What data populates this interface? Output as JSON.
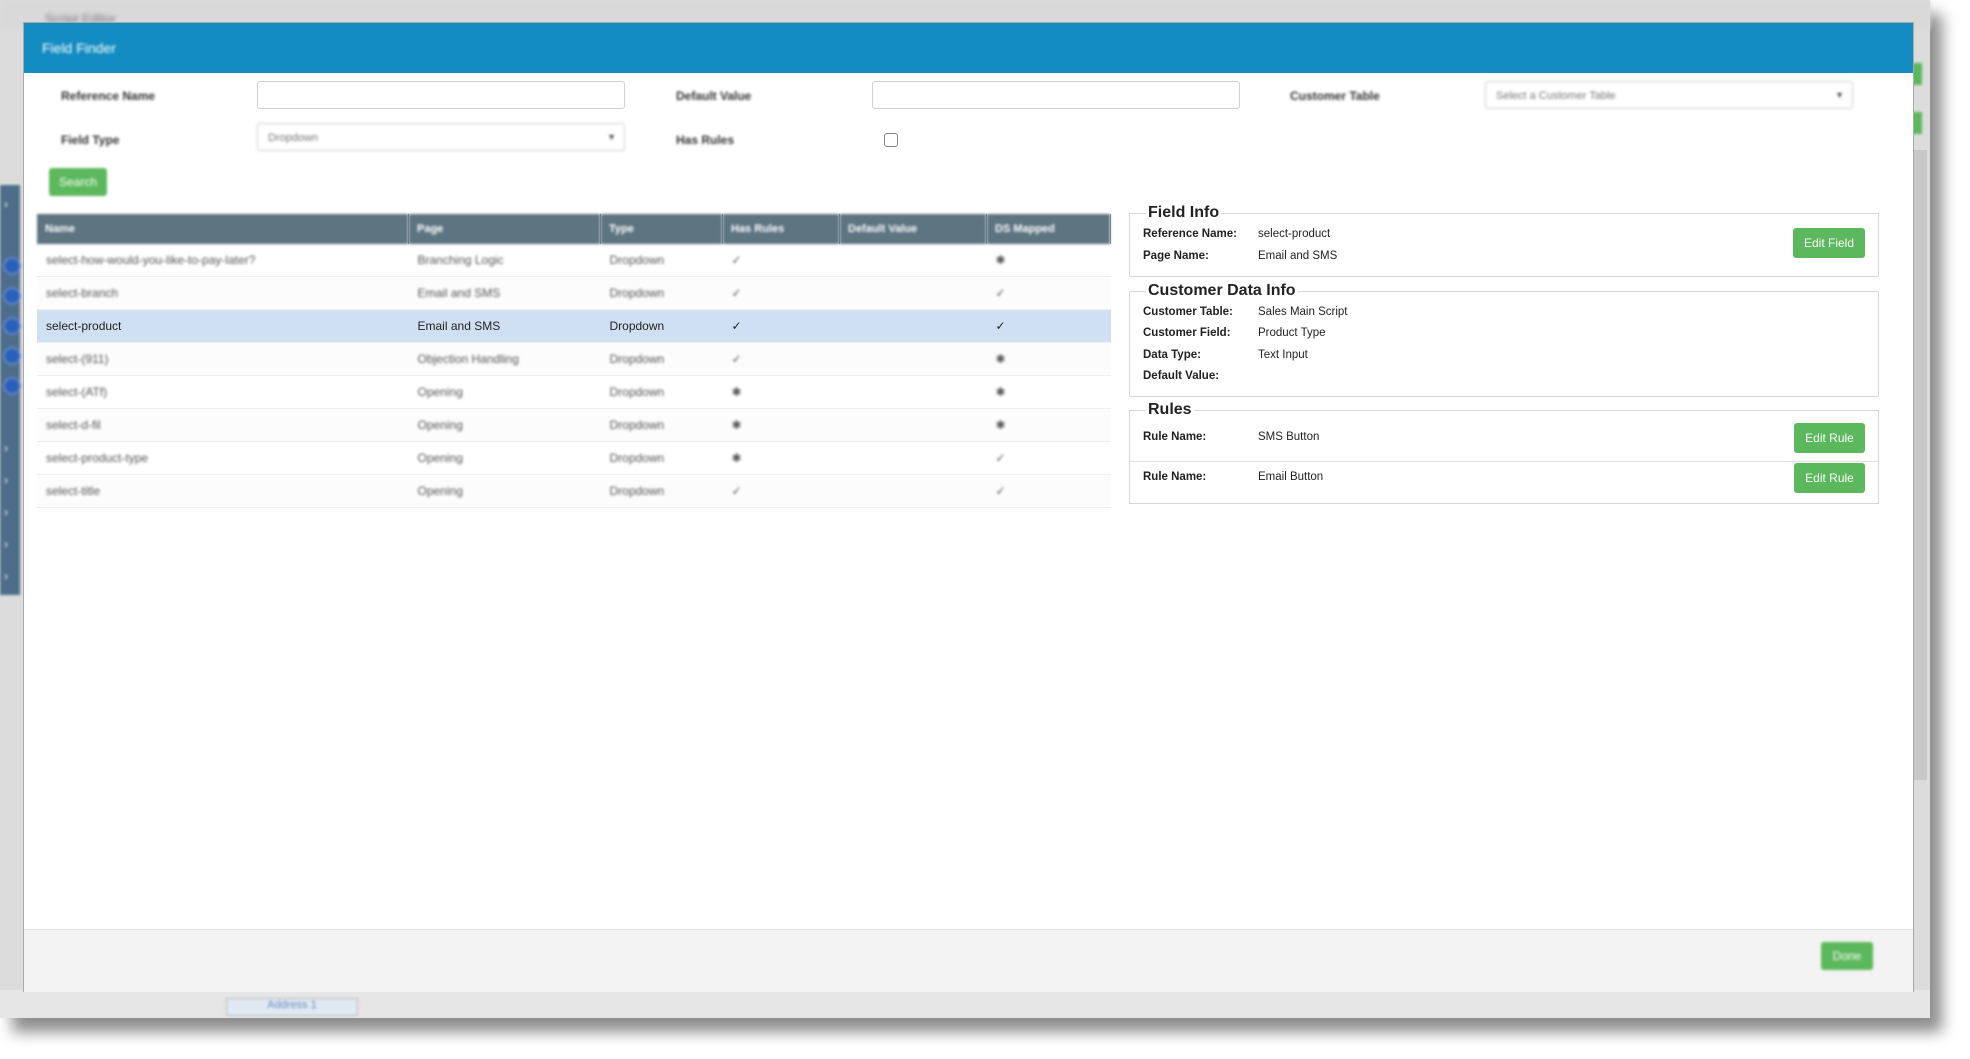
{
  "app": {
    "title": "Script Editor",
    "bottom_tab": "Address 1"
  },
  "modal": {
    "title": "Field Finder",
    "filters": {
      "reference_name_label": "Reference Name",
      "reference_name_value": "",
      "default_value_label": "Default Value",
      "default_value_value": "",
      "customer_table_label": "Customer Table",
      "customer_table_placeholder": "Select a Customer Table",
      "field_type_label": "Field Type",
      "field_type_value": "Dropdown",
      "has_rules_label": "Has Rules",
      "search_label": "Search"
    },
    "table": {
      "headers": [
        "Name",
        "Page",
        "Type",
        "Has Rules",
        "Default Value",
        "DS Mapped"
      ],
      "rows": [
        {
          "name": "select-how-would-you-like-to-pay-later?",
          "page": "Branching Logic",
          "type": "Dropdown",
          "has_rules": "✓",
          "default_value": "",
          "ds_mapped": "✱"
        },
        {
          "name": "select-branch",
          "page": "Email and SMS",
          "type": "Dropdown",
          "has_rules": "✓",
          "default_value": "",
          "ds_mapped": "✓"
        },
        {
          "name": "select-product",
          "page": "Email and SMS",
          "type": "Dropdown",
          "has_rules": "✓",
          "default_value": "",
          "ds_mapped": "✓"
        },
        {
          "name": "select-(911)",
          "page": "Objection Handling",
          "type": "Dropdown",
          "has_rules": "✓",
          "default_value": "",
          "ds_mapped": "✱"
        },
        {
          "name": "select-(ATf)",
          "page": "Opening",
          "type": "Dropdown",
          "has_rules": "✱",
          "default_value": "",
          "ds_mapped": "✱"
        },
        {
          "name": "select-d-fil",
          "page": "Opening",
          "type": "Dropdown",
          "has_rules": "✱",
          "default_value": "",
          "ds_mapped": "✱"
        },
        {
          "name": "select-product-type",
          "page": "Opening",
          "type": "Dropdown",
          "has_rules": "✱",
          "default_value": "",
          "ds_mapped": "✓"
        },
        {
          "name": "select-title",
          "page": "Opening",
          "type": "Dropdown",
          "has_rules": "✓",
          "default_value": "",
          "ds_mapped": "✓"
        }
      ]
    },
    "field_info": {
      "title": "Field Info",
      "reference_name_label": "Reference Name:",
      "reference_name_value": "select-product",
      "page_name_label": "Page Name:",
      "page_name_value": "Email and SMS",
      "edit_field_label": "Edit Field"
    },
    "customer_data_info": {
      "title": "Customer Data Info",
      "customer_table_label": "Customer Table:",
      "customer_table_value": "Sales Main Script",
      "customer_field_label": "Customer Field:",
      "customer_field_value": "Product Type",
      "data_type_label": "Data Type:",
      "data_type_value": "Text Input",
      "default_value_label": "Default Value:",
      "default_value_value": ""
    },
    "rules": {
      "title": "Rules",
      "items": [
        {
          "label": "Rule Name:",
          "value": "SMS Button",
          "button": "Edit Rule"
        },
        {
          "label": "Rule Name:",
          "value": "Email Button",
          "button": "Edit Rule"
        }
      ]
    },
    "footer": {
      "done_label": "Done"
    }
  },
  "colors": {
    "header_blue": "#138cc2",
    "table_header": "#5d7481",
    "selected_row": "#cfe0f3",
    "green_button": "#5cb85c"
  }
}
